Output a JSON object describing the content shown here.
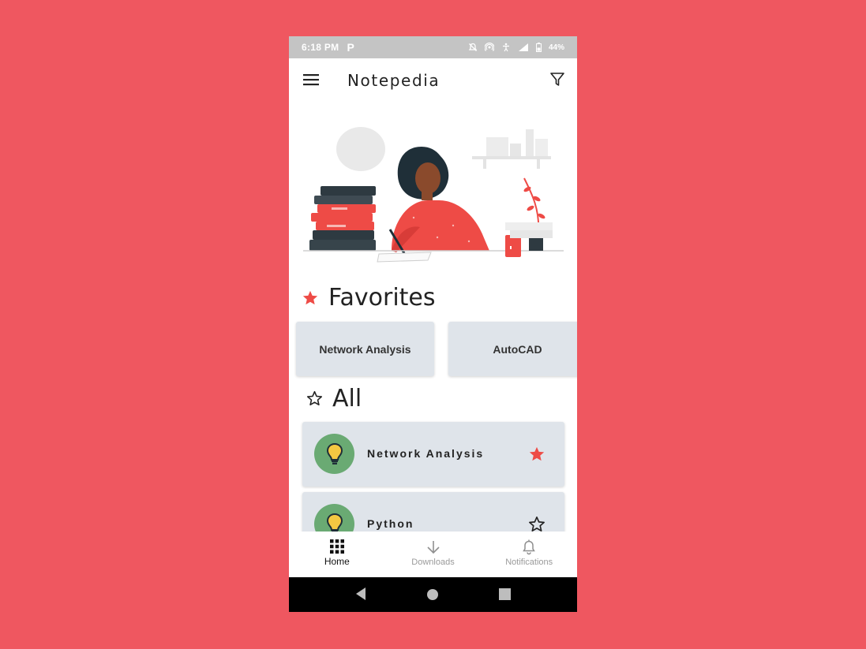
{
  "status_bar": {
    "time": "6:18 PM",
    "notification_icon": "P",
    "battery": "44%"
  },
  "app_bar": {
    "title": "Notepedia",
    "menu_icon": "hamburger-icon",
    "filter_icon": "filter-icon"
  },
  "favorites": {
    "heading": "Favorites",
    "items": [
      {
        "label": "Network Analysis"
      },
      {
        "label": "AutoCAD"
      }
    ]
  },
  "all": {
    "heading": "All",
    "items": [
      {
        "label": "Network Analysis",
        "favorited": true
      },
      {
        "label": "Python",
        "favorited": false
      }
    ]
  },
  "bottom_nav": {
    "tabs": [
      {
        "label": "Home",
        "icon": "grid-icon",
        "active": true
      },
      {
        "label": "Downloads",
        "icon": "download-icon",
        "active": false
      },
      {
        "label": "Notifications",
        "icon": "bell-icon",
        "active": false
      }
    ]
  },
  "colors": {
    "background": "#ef5760",
    "accent_red": "#ee4b46",
    "card": "#dfe4ea",
    "bulb_circle": "#6aaa73",
    "bulb": "#f4c842"
  }
}
